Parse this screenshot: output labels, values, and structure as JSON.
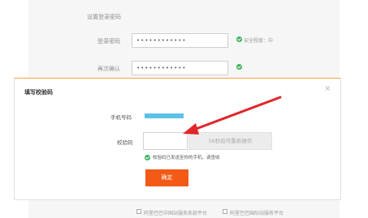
{
  "background_form": {
    "section_title": "设置登录密码",
    "password_label": "登录密码",
    "password_value": "••••••••••••",
    "password_strength": "安全程度：中",
    "confirm_label": "再次确认",
    "confirm_value": "••••••••••••",
    "agreement_cn": "阿里巴巴中国站服务条款平台",
    "agreement_intl": "阿里巴巴国际站服务平台"
  },
  "modal": {
    "title": "填写校验码",
    "close_symbol": "×",
    "phone_label": "手机号码",
    "code_label": "校验码",
    "code_value": "",
    "resend_label": "56秒后可重新操作",
    "notice_text": "校验码已发送至你的手机，请查收",
    "confirm_label": "确定"
  },
  "colors": {
    "confirm_button": "#f25a16",
    "arrow": "#e0262b",
    "phone_mask": "#5ec1e8",
    "success_green": "#3bb15a"
  }
}
